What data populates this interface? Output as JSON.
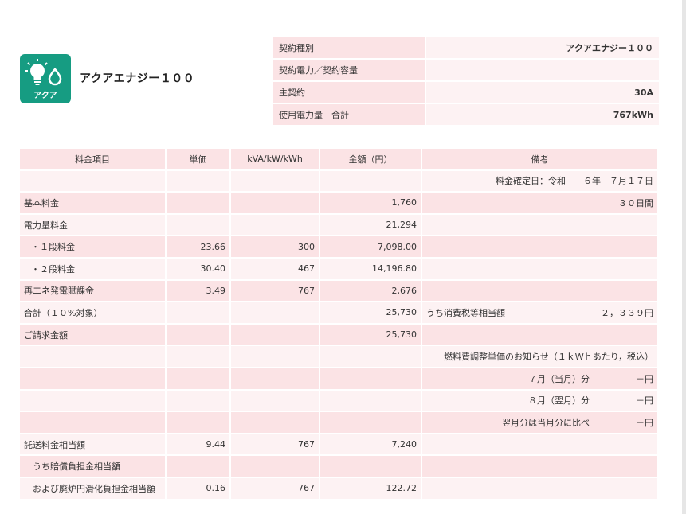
{
  "logo": {
    "text": "アクア",
    "bg_color": "#169c82",
    "icon": "bulb-and-drop-icon"
  },
  "plan_name": "アクアエナジー１００",
  "contract": [
    {
      "label": "契約種別",
      "value": "アクアエナジー１００"
    },
    {
      "label": "契約電力／契約容量",
      "value": ""
    },
    {
      "label": "主契約",
      "value": "30A"
    },
    {
      "label": "使用電力量　合計",
      "value": "767kWh"
    }
  ],
  "billing": {
    "headers": [
      "料金項目",
      "単価",
      "kVA/kW/kWh",
      "金額（円）",
      "備考"
    ],
    "rows": [
      {
        "item": "",
        "price": "",
        "qty": "",
        "amount": "",
        "note": "料金確定日：令和　　６年　７月１７日",
        "note_value": ""
      },
      {
        "item": "基本料金",
        "price": "",
        "qty": "",
        "amount": "1,760",
        "note": "",
        "note_value": "３０日間"
      },
      {
        "item": "電力量料金",
        "price": "",
        "qty": "",
        "amount": "21,294",
        "note": "",
        "note_value": ""
      },
      {
        "item": "・１段料金",
        "price": "23.66",
        "qty": "300",
        "amount": "7,098.00",
        "note": "",
        "note_value": ""
      },
      {
        "item": "・２段料金",
        "price": "30.40",
        "qty": "467",
        "amount": "14,196.80",
        "note": "",
        "note_value": ""
      },
      {
        "item": "再エネ発電賦課金",
        "price": "3.49",
        "qty": "767",
        "amount": "2,676",
        "note": "",
        "note_value": ""
      },
      {
        "item": "合計（１０%対象）",
        "price": "",
        "qty": "",
        "amount": "25,730",
        "note": "うち消費税等相当額",
        "note_value": "２，３３９円"
      },
      {
        "item": "ご請求金額",
        "price": "",
        "qty": "",
        "amount": "25,730",
        "note": "",
        "note_value": ""
      },
      {
        "item": "",
        "price": "",
        "qty": "",
        "amount": "",
        "note": "燃料費調整単価のお知らせ（１ｋＷｈあたり，税込）",
        "note_value": ""
      },
      {
        "item": "",
        "price": "",
        "qty": "",
        "amount": "",
        "note": "７月（当月）分",
        "note_value": "－円"
      },
      {
        "item": "",
        "price": "",
        "qty": "",
        "amount": "",
        "note": "８月（翌月）分",
        "note_value": "－円"
      },
      {
        "item": "",
        "price": "",
        "qty": "",
        "amount": "",
        "note": "翌月分は当月分に比べ",
        "note_value": "－円"
      },
      {
        "item": "託送料金相当額",
        "price": "9.44",
        "qty": "767",
        "amount": "7,240",
        "note": "",
        "note_value": ""
      },
      {
        "item": "うち賠償負担金相当額",
        "price": "",
        "qty": "",
        "amount": "",
        "note": "",
        "note_value": ""
      },
      {
        "item": "および廃炉円滑化負担金相当額",
        "price": "0.16",
        "qty": "767",
        "amount": "122.72",
        "note": "",
        "note_value": ""
      }
    ]
  }
}
